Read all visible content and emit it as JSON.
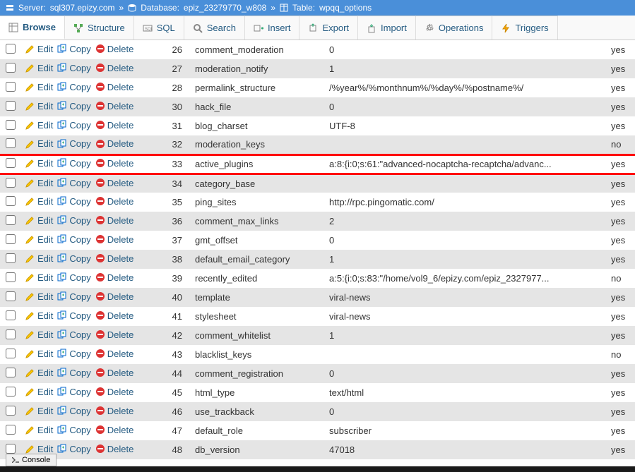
{
  "breadcrumb": {
    "server_label": "Server:",
    "server": "sql307.epizy.com",
    "db_label": "Database:",
    "db": "epiz_23279770_w808",
    "table_label": "Table:",
    "table": "wpqq_options"
  },
  "tabs": [
    {
      "label": "Browse",
      "icon": "browse"
    },
    {
      "label": "Structure",
      "icon": "structure"
    },
    {
      "label": "SQL",
      "icon": "sql"
    },
    {
      "label": "Search",
      "icon": "search"
    },
    {
      "label": "Insert",
      "icon": "insert"
    },
    {
      "label": "Export",
      "icon": "export"
    },
    {
      "label": "Import",
      "icon": "import"
    },
    {
      "label": "Operations",
      "icon": "operations"
    },
    {
      "label": "Triggers",
      "icon": "triggers"
    }
  ],
  "actions": {
    "edit": "Edit",
    "copy": "Copy",
    "delete": "Delete"
  },
  "rows": [
    {
      "id": "26",
      "name": "comment_moderation",
      "value": "0",
      "autoload": "yes"
    },
    {
      "id": "27",
      "name": "moderation_notify",
      "value": "1",
      "autoload": "yes"
    },
    {
      "id": "28",
      "name": "permalink_structure",
      "value": "/%year%/%monthnum%/%day%/%postname%/",
      "autoload": "yes"
    },
    {
      "id": "30",
      "name": "hack_file",
      "value": "0",
      "autoload": "yes"
    },
    {
      "id": "31",
      "name": "blog_charset",
      "value": "UTF-8",
      "autoload": "yes"
    },
    {
      "id": "32",
      "name": "moderation_keys",
      "value": "",
      "autoload": "no"
    },
    {
      "id": "33",
      "name": "active_plugins",
      "value": "a:8:{i:0;s:61:\"advanced-nocaptcha-recaptcha/advanc...",
      "autoload": "yes",
      "highlight": true
    },
    {
      "id": "34",
      "name": "category_base",
      "value": "",
      "autoload": "yes"
    },
    {
      "id": "35",
      "name": "ping_sites",
      "value": "http://rpc.pingomatic.com/",
      "autoload": "yes"
    },
    {
      "id": "36",
      "name": "comment_max_links",
      "value": "2",
      "autoload": "yes"
    },
    {
      "id": "37",
      "name": "gmt_offset",
      "value": "0",
      "autoload": "yes"
    },
    {
      "id": "38",
      "name": "default_email_category",
      "value": "1",
      "autoload": "yes"
    },
    {
      "id": "39",
      "name": "recently_edited",
      "value": "a:5:{i:0;s:83:\"/home/vol9_6/epizy.com/epiz_2327977...",
      "autoload": "no"
    },
    {
      "id": "40",
      "name": "template",
      "value": "viral-news",
      "autoload": "yes"
    },
    {
      "id": "41",
      "name": "stylesheet",
      "value": "viral-news",
      "autoload": "yes"
    },
    {
      "id": "42",
      "name": "comment_whitelist",
      "value": "1",
      "autoload": "yes"
    },
    {
      "id": "43",
      "name": "blacklist_keys",
      "value": "",
      "autoload": "no"
    },
    {
      "id": "44",
      "name": "comment_registration",
      "value": "0",
      "autoload": "yes"
    },
    {
      "id": "45",
      "name": "html_type",
      "value": "text/html",
      "autoload": "yes"
    },
    {
      "id": "46",
      "name": "use_trackback",
      "value": "0",
      "autoload": "yes"
    },
    {
      "id": "47",
      "name": "default_role",
      "value": "subscriber",
      "autoload": "yes"
    },
    {
      "id": "48",
      "name": "db_version",
      "value": "47018",
      "autoload": "yes"
    }
  ],
  "console": "Console"
}
